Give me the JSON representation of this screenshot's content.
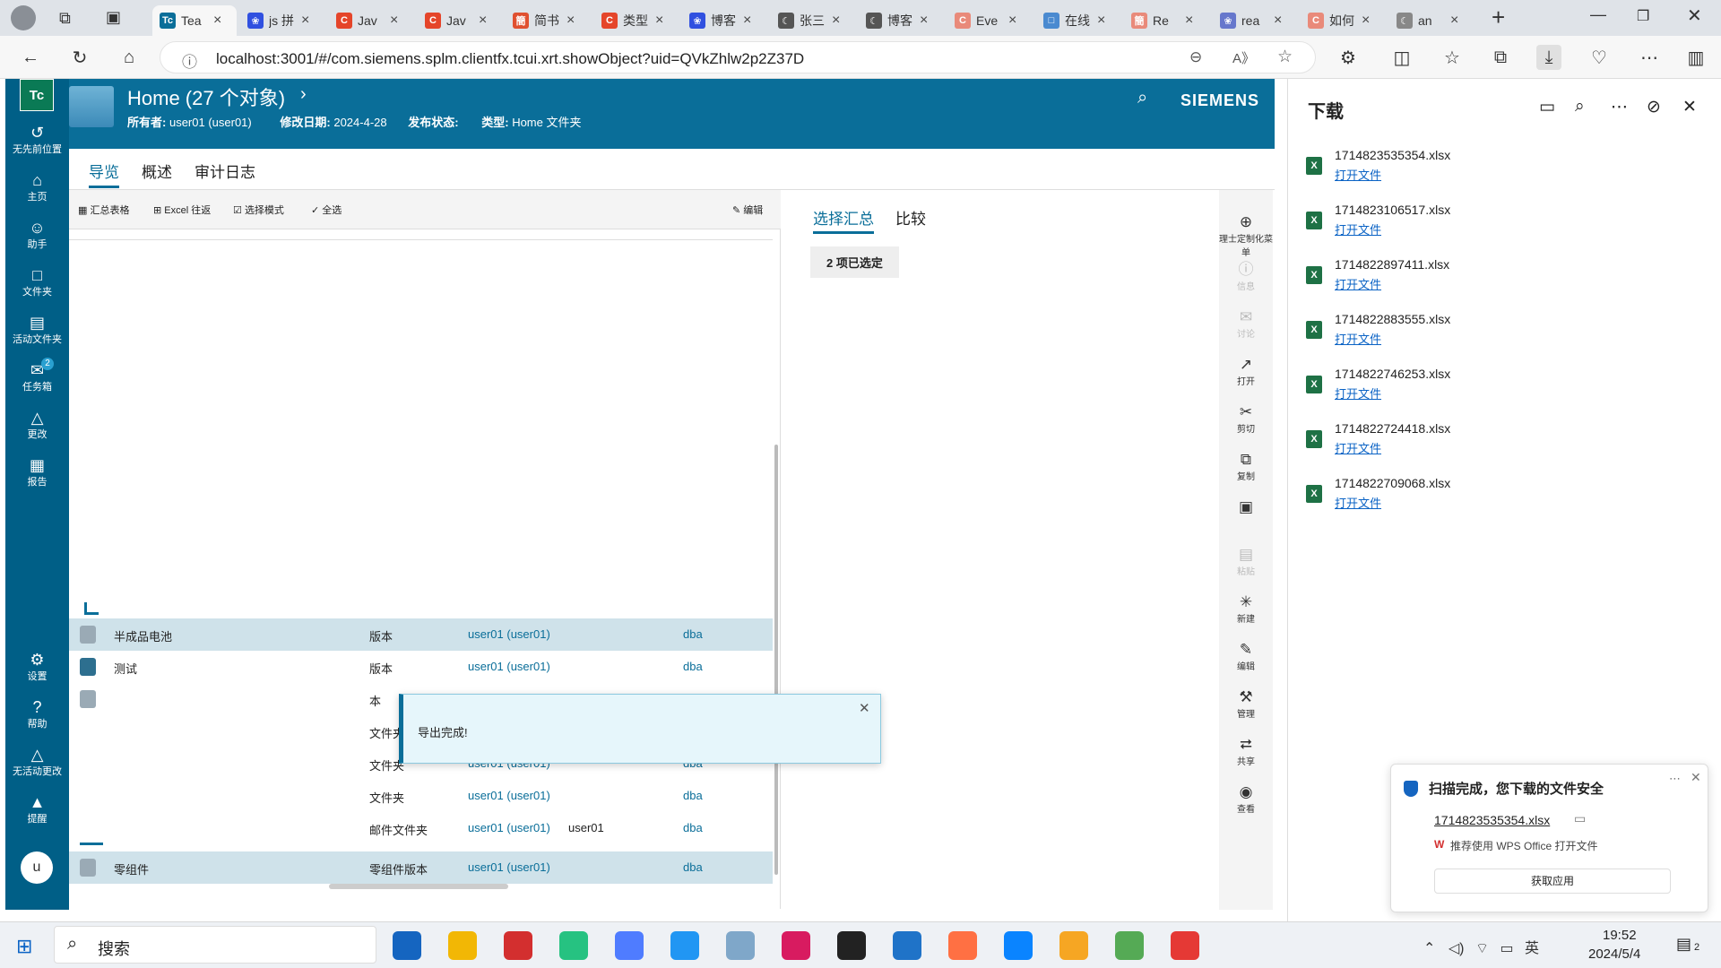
{
  "browser": {
    "tabs": [
      {
        "label": "Tea",
        "color": "#0a6e99",
        "glyph": "Tc",
        "active": true
      },
      {
        "label": "js 拼",
        "color": "#3050e0",
        "glyph": "❀"
      },
      {
        "label": "Jav",
        "color": "#e5452a",
        "glyph": "C"
      },
      {
        "label": "Jav",
        "color": "#e5452a",
        "glyph": "C"
      },
      {
        "label": "简书",
        "color": "#e05030",
        "glyph": "簡"
      },
      {
        "label": "类型",
        "color": "#e5452a",
        "glyph": "C"
      },
      {
        "label": "博客",
        "color": "#3050e0",
        "glyph": "❀"
      },
      {
        "label": "张三",
        "color": "#555555",
        "glyph": "☾"
      },
      {
        "label": "博客",
        "color": "#555555",
        "glyph": "☾"
      },
      {
        "label": "Eve",
        "color": "#e98a7a",
        "glyph": "C"
      },
      {
        "label": "在线",
        "color": "#4a8ad0",
        "glyph": "□"
      },
      {
        "label": "Re",
        "color": "#e98a7a",
        "glyph": "簡"
      },
      {
        "label": "rea",
        "color": "#6677cc",
        "glyph": "❀"
      },
      {
        "label": "如何",
        "color": "#e98a7a",
        "glyph": "C"
      },
      {
        "label": "an",
        "color": "#888888",
        "glyph": "☾"
      }
    ],
    "url": "localhost:3001/#/com.siemens.splm.clientfx.tcui.xrt.showObject?uid=QVkZhlw2p2Z37D"
  },
  "leftnav": {
    "logo": "Tc",
    "items": [
      {
        "label": "无先前位置",
        "icon": "↺"
      },
      {
        "label": "主页",
        "icon": "⌂"
      },
      {
        "label": "助手",
        "icon": "☺"
      },
      {
        "label": "文件夹",
        "icon": "□"
      },
      {
        "label": "活动文件夹",
        "icon": "▤"
      },
      {
        "label": "任务箱",
        "icon": "✉",
        "badge": "2"
      },
      {
        "label": "更改",
        "icon": "△"
      },
      {
        "label": "报告",
        "icon": "▦"
      }
    ],
    "bottom_items": [
      {
        "label": "设置",
        "icon": "⚙"
      },
      {
        "label": "帮助",
        "icon": "?"
      },
      {
        "label": "无活动更改",
        "icon": "△"
      },
      {
        "label": "提醒",
        "icon": "▲"
      }
    ],
    "avatar": "u"
  },
  "header": {
    "title": "Home (27 个对象)",
    "owner_label": "所有者:",
    "owner_value": "user01 (user01)",
    "modified_label": "修改日期:",
    "modified_value": "2024-4-28",
    "release_label": "发布状态:",
    "type_label": "类型:",
    "type_value": "Home 文件夹",
    "brand": "SIEMENS"
  },
  "apptabs": [
    "导览",
    "概述",
    "审计日志"
  ],
  "toolbar": {
    "summary_table": "汇总表格",
    "excel": "Excel 往返",
    "select_mode": "选择模式",
    "select_all": "全选",
    "edit": "编辑"
  },
  "rows": [
    {
      "name": "半成品电池",
      "type": "版本",
      "owner": "user01 (user01)",
      "user": "",
      "group": "dba",
      "selected": true
    },
    {
      "name": "测试",
      "type": "版本",
      "owner": "user01 (user01)",
      "user": "",
      "group": "dba",
      "selected": false
    },
    {
      "name": "",
      "type": "本",
      "owner": "",
      "user": "",
      "group": "",
      "selected": false
    },
    {
      "name": "",
      "type": "文件夹",
      "owner": "",
      "user": "",
      "group": "",
      "selected": false
    },
    {
      "name": "",
      "type": "文件夹",
      "owner": "user01 (user01)",
      "user": "",
      "group": "dba",
      "selected": false
    },
    {
      "name": "",
      "type": "文件夹",
      "owner": "user01 (user01)",
      "user": "",
      "group": "dba",
      "selected": false
    },
    {
      "name": "",
      "type": "邮件文件夹",
      "owner": "user01 (user01)",
      "user": "user01",
      "group": "dba",
      "selected": false
    },
    {
      "name": "零组件",
      "type": "零组件版本",
      "owner": "user01 (user01)",
      "user": "",
      "group": "dba",
      "selected": true
    }
  ],
  "right": {
    "tab_summary": "选择汇总",
    "tab_compare": "比较",
    "selected_count": "2 项已选定"
  },
  "rail": [
    {
      "label": "理士定制化菜单",
      "icon": "⊕",
      "dim": false
    },
    {
      "label": "信息",
      "icon": "ⓘ",
      "dim": true
    },
    {
      "label": "讨论",
      "icon": "✉",
      "dim": true
    },
    {
      "label": "打开",
      "icon": "↗",
      "dim": false
    },
    {
      "label": "剪切",
      "icon": "✂",
      "dim": false
    },
    {
      "label": "复制",
      "icon": "⧉",
      "dim": false
    },
    {
      "label": "",
      "icon": "▣",
      "dim": false
    },
    {
      "label": "粘贴",
      "icon": "▤",
      "dim": true
    },
    {
      "label": "新建",
      "icon": "✳",
      "dim": false
    },
    {
      "label": "编辑",
      "icon": "✎",
      "dim": false
    },
    {
      "label": "管理",
      "icon": "⚒",
      "dim": false
    },
    {
      "label": "共享",
      "icon": "⮂",
      "dim": false
    },
    {
      "label": "查看",
      "icon": "◉",
      "dim": false
    }
  ],
  "toast": {
    "message": "导出完成!"
  },
  "downloads": {
    "title": "下载",
    "open_label": "打开文件",
    "files": [
      "1714823535354.xlsx",
      "1714823106517.xlsx",
      "1714822897411.xlsx",
      "1714822883555.xlsx",
      "1714822746253.xlsx",
      "1714822724418.xlsx",
      "1714822709068.xlsx"
    ],
    "scan": {
      "title": "扫描完成，您下载的文件安全",
      "file": "1714823535354.xlsx",
      "wps": "推荐使用 WPS Office 打开文件",
      "button": "获取应用"
    }
  },
  "taskbar": {
    "search": "搜索",
    "ime": "英",
    "time": "19:52",
    "date": "2024/5/4",
    "notif": "2",
    "apps": [
      "#1565c0",
      "#f2b705",
      "#d32f2f",
      "#26c281",
      "#4f7cff",
      "#2196f3",
      "#7fa7c9",
      "#d81b60",
      "#222222",
      "#1f73c8",
      "#ff7043",
      "#0a84ff",
      "#f6a623",
      "#55aa55",
      "#e53935"
    ]
  }
}
